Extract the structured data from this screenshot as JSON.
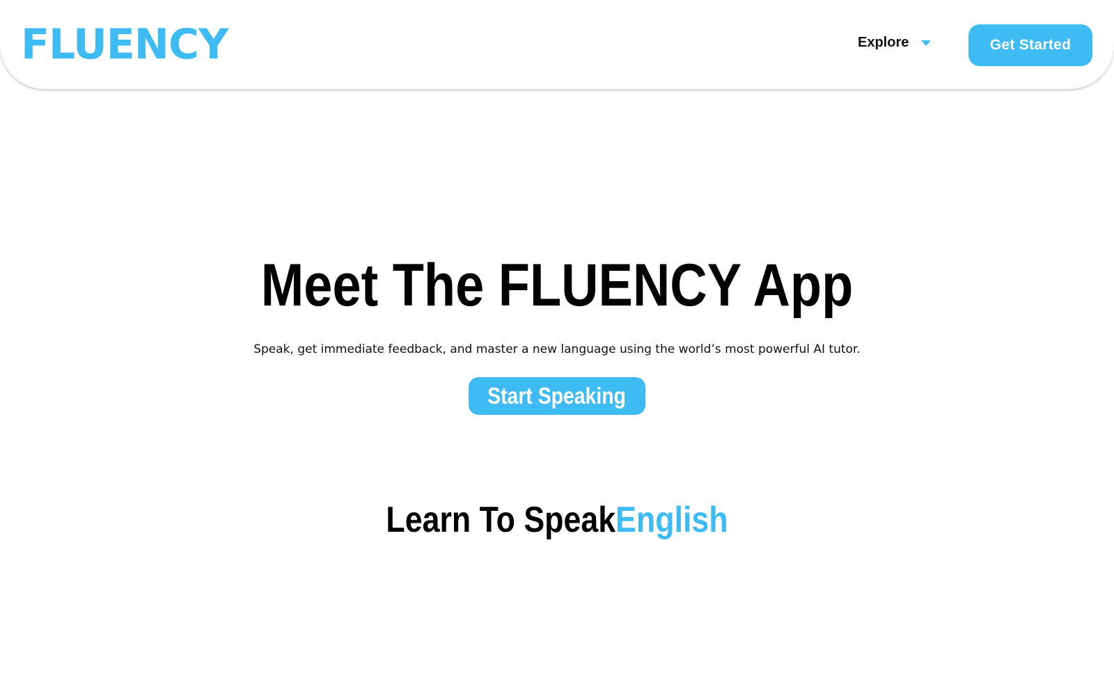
{
  "colors": {
    "accent": "#3ebbf3",
    "text": "#000000",
    "background": "#ffffff"
  },
  "nav": {
    "logo": "FLUENCY",
    "explore_label": "Explore",
    "explore_icon": "chevron-down-icon",
    "cta_label": "Get Started"
  },
  "hero": {
    "title": "Meet The FLUENCY App",
    "subtitle": "Speak, get immediate feedback, and master a new language using the world’s most powerful AI tutor.",
    "cta_label": "Start Speaking"
  },
  "learn": {
    "prefix": "Learn To Speak",
    "language": "English"
  }
}
